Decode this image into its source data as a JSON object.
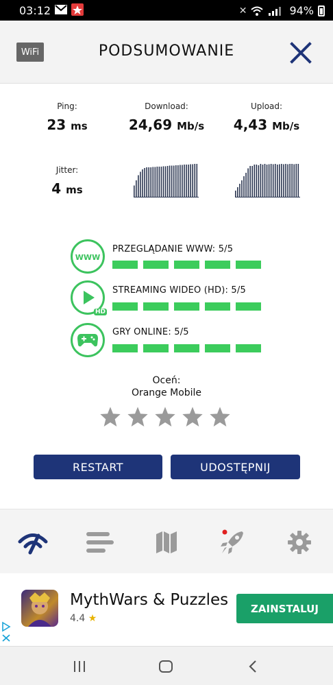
{
  "status_bar": {
    "time": "03:12",
    "battery": "94%"
  },
  "header": {
    "network_badge": "WiFi",
    "title": "PODSUMOWANIE"
  },
  "stats": {
    "ping": {
      "label": "Ping:",
      "value": "23",
      "unit": "ms"
    },
    "download": {
      "label": "Download:",
      "value": "24,69",
      "unit": "Mb/s"
    },
    "upload": {
      "label": "Upload:",
      "value": "4,43",
      "unit": "Mb/s"
    },
    "jitter": {
      "label": "Jitter:",
      "value": "4",
      "unit": "ms"
    },
    "download_graph": [
      0.35,
      0.5,
      0.65,
      0.75,
      0.82,
      0.86,
      0.88,
      0.88,
      0.88,
      0.89,
      0.89,
      0.9,
      0.9,
      0.9,
      0.91,
      0.91,
      0.92,
      0.93,
      0.93,
      0.93,
      0.94,
      0.94,
      0.95,
      0.95,
      0.96,
      0.96,
      0.96,
      0.97,
      0.97,
      0.98,
      0.98
    ],
    "upload_graph": [
      0.2,
      0.3,
      0.4,
      0.5,
      0.62,
      0.72,
      0.85,
      0.92,
      0.92,
      0.96,
      0.96,
      0.94,
      0.98,
      0.96,
      0.98,
      0.96,
      0.97,
      0.98,
      0.97,
      0.98,
      0.96,
      0.97,
      0.98,
      0.97,
      0.98,
      0.97,
      0.98,
      0.98,
      0.97,
      0.98,
      0.98
    ]
  },
  "quality": [
    {
      "icon": "www-icon",
      "label": "PRZEGLĄDANIE WWW: 5/5",
      "score": 5,
      "max": 5
    },
    {
      "icon": "play-hd-icon",
      "label": "STREAMING WIDEO (HD): 5/5",
      "score": 5,
      "max": 5
    },
    {
      "icon": "gamepad-icon",
      "label": "GRY ONLINE: 5/5",
      "score": 5,
      "max": 5
    }
  ],
  "rating": {
    "prompt": "Oceń:",
    "provider": "Orange Mobile",
    "stars": 0,
    "max_stars": 5
  },
  "buttons": {
    "restart": "RESTART",
    "share": "UDOSTĘPNIJ"
  },
  "bottom_nav": [
    "speed-icon",
    "results-list-icon",
    "map-icon",
    "rocket-icon",
    "settings-gear-icon"
  ],
  "ad": {
    "title": "MythWars & Puzzles",
    "rating": "4.4",
    "cta": "ZAINSTALUJ"
  },
  "colors": {
    "brand_navy": "#1e3478",
    "quality_green": "#3ccc5c",
    "install_green": "#1aa068",
    "graph_bar": "#2a3550"
  }
}
